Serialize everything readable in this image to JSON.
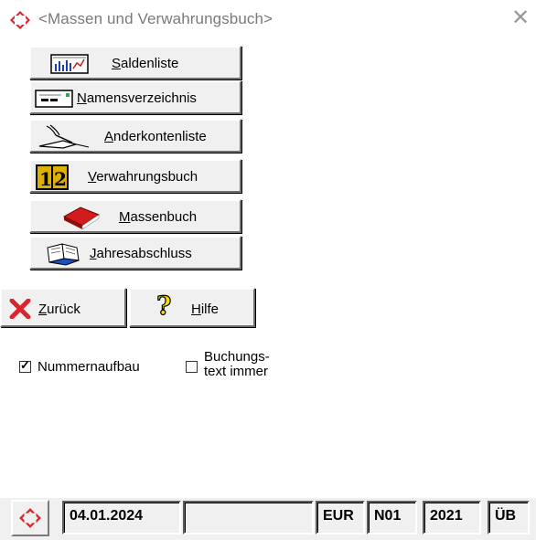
{
  "window": {
    "title": "<Massen und Verwahrungsbuch>",
    "close_glyph": "✕"
  },
  "menu": [
    {
      "label": "Saldenliste",
      "icon": "chart-icon"
    },
    {
      "label": "Namensverzeichnis",
      "icon": "card-icon"
    },
    {
      "label": "Anderkontenliste",
      "icon": "hand-pen-icon"
    },
    {
      "label": "Verwahrungsbuch",
      "icon": "ledger-12-icon"
    },
    {
      "label": "Massenbuch",
      "icon": "red-book-icon"
    },
    {
      "label": "Jahresabschluss",
      "icon": "open-book-icon"
    }
  ],
  "actions": {
    "back_label": "Zurück",
    "help_label": "Hilfe"
  },
  "options": {
    "nummernaufbau_label": "Nummernaufbau",
    "nummernaufbau_checked": true,
    "buchungstext_line1": "Buchungs-",
    "buchungstext_line2": "text immer",
    "buchungstext_checked": false
  },
  "status": {
    "date": "04.01.2024",
    "empty": "",
    "currency": "EUR",
    "code": "N01",
    "year": "2021",
    "flag": "ÜB"
  },
  "colors": {
    "accent_red": "#d8252e",
    "button_face": "#f0f0f0"
  }
}
